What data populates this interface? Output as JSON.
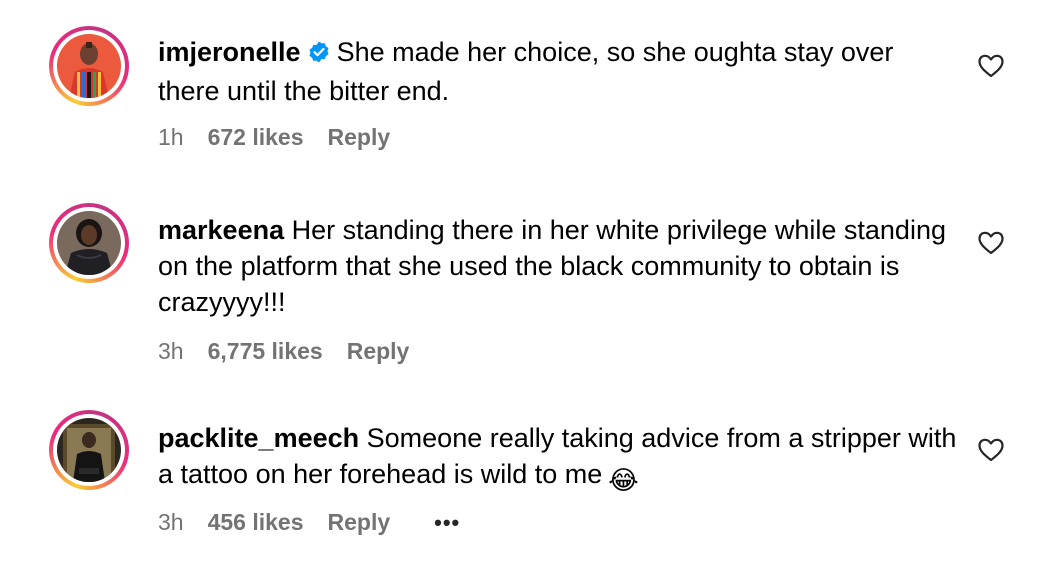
{
  "comments": [
    {
      "username": "imjeronelle",
      "verified": true,
      "text": "She made her choice, so she oughta stay over there until the bitter end.",
      "time": "1h",
      "likes": "672 likes",
      "reply": "Reply",
      "avatar_color": "#e8513a"
    },
    {
      "username": "markeena",
      "verified": false,
      "text": "Her standing there in her white privilege while standing on the platform that she used the black community to obtain is crazyyyy!!!",
      "time": "3h",
      "likes": "6,775 likes",
      "reply": "Reply",
      "avatar_color": "#2b2b2b"
    },
    {
      "username": "packlite_meech",
      "verified": false,
      "text": "Someone really taking advice from a stripper with a tattoo on her forehead is wild to me",
      "emoji": "😂",
      "time": "3h",
      "likes": "456 likes",
      "reply": "Reply",
      "more": "•••",
      "avatar_color": "#1c1c1c"
    }
  ],
  "colors": {
    "meta_text": "#737373",
    "verified_badge": "#0095f6"
  }
}
